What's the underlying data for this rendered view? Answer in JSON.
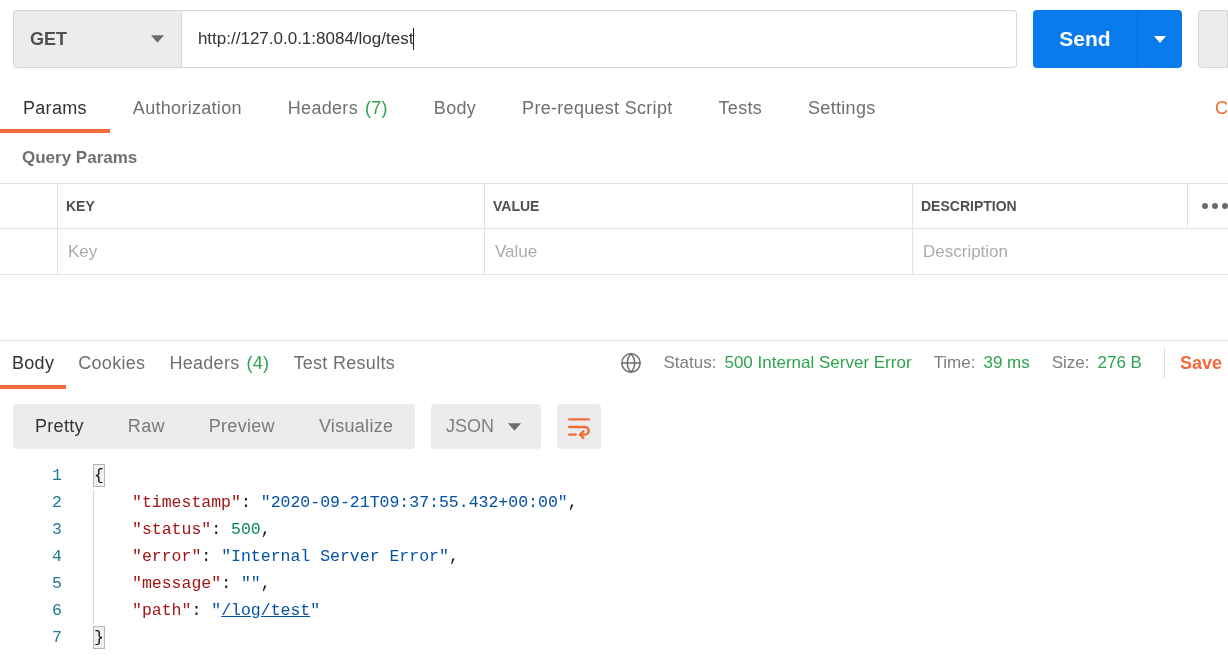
{
  "request": {
    "method": "GET",
    "url": "http://127.0.0.1:8084/log/test",
    "url_focused": true,
    "send": "Send"
  },
  "request_tabs": [
    {
      "label": "Params",
      "selected": true
    },
    {
      "label": "Authorization",
      "selected": false
    },
    {
      "label": "Headers",
      "count": "(7)",
      "selected": false
    },
    {
      "label": "Body",
      "selected": false
    },
    {
      "label": "Pre-request Script",
      "selected": false
    },
    {
      "label": "Tests",
      "selected": false
    },
    {
      "label": "Settings",
      "selected": false
    }
  ],
  "request_tabs_trailing_link": "C",
  "query_params": {
    "title": "Query Params",
    "columns": [
      {
        "heading": "KEY",
        "placeholder": "Key"
      },
      {
        "heading": "VALUE",
        "placeholder": "Value"
      },
      {
        "heading": "DESCRIPTION",
        "placeholder": "Description"
      }
    ]
  },
  "response": {
    "tabs": [
      {
        "label": "Body",
        "selected": true
      },
      {
        "label": "Cookies",
        "selected": false
      },
      {
        "label": "Headers",
        "count": "(4)",
        "selected": false
      },
      {
        "label": "Test Results",
        "selected": false
      }
    ],
    "stats": [
      {
        "label": "Status:",
        "value": "500 Internal Server Error"
      },
      {
        "label": "Time:",
        "value": "39 ms"
      },
      {
        "label": "Size:",
        "value": "276 B"
      }
    ],
    "save": "Save",
    "views": [
      {
        "label": "Pretty",
        "selected": true
      },
      {
        "label": "Raw",
        "selected": false
      },
      {
        "label": "Preview",
        "selected": false
      },
      {
        "label": "Visualize",
        "selected": false
      }
    ],
    "format": "JSON",
    "lines": [
      {
        "number": "1",
        "tokens": [
          {
            "kind": "bracket",
            "text": "{"
          }
        ],
        "children": [
          {
            "number": "2",
            "tokens": [
              {
                "kind": "key",
                "text": "\"timestamp\""
              },
              {
                "kind": "punct",
                "text": ": "
              },
              {
                "kind": "string",
                "text": "\"2020-09-21T09:37:55.432+00:00\""
              },
              {
                "kind": "punct",
                "text": ","
              }
            ]
          },
          {
            "number": "3",
            "tokens": [
              {
                "kind": "key",
                "text": "\"status\""
              },
              {
                "kind": "punct",
                "text": ": "
              },
              {
                "kind": "number",
                "text": "500"
              },
              {
                "kind": "punct",
                "text": ","
              }
            ]
          },
          {
            "number": "4",
            "tokens": [
              {
                "kind": "key",
                "text": "\"error\""
              },
              {
                "kind": "punct",
                "text": ": "
              },
              {
                "kind": "string",
                "text": "\"Internal Server Error\""
              },
              {
                "kind": "punct",
                "text": ","
              }
            ]
          },
          {
            "number": "5",
            "tokens": [
              {
                "kind": "key",
                "text": "\"message\""
              },
              {
                "kind": "punct",
                "text": ": "
              },
              {
                "kind": "string",
                "text": "\"\""
              },
              {
                "kind": "punct",
                "text": ","
              }
            ]
          },
          {
            "number": "6",
            "tokens": [
              {
                "kind": "key",
                "text": "\"path\""
              },
              {
                "kind": "punct",
                "text": ": "
              },
              {
                "kind": "string",
                "text": "\""
              },
              {
                "kind": "link",
                "text": "/log/test"
              },
              {
                "kind": "string",
                "text": "\""
              }
            ]
          }
        ]
      },
      {
        "number": "7",
        "tokens": [
          {
            "kind": "bracket",
            "text": "}"
          }
        ]
      }
    ]
  }
}
